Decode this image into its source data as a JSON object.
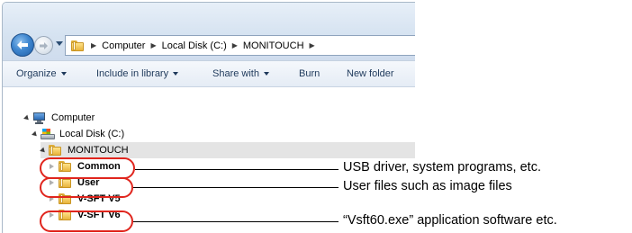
{
  "address_bar": {
    "segments": [
      "Computer",
      "Local Disk (C:)",
      "MONITOUCH"
    ]
  },
  "toolbar": {
    "organize": "Organize",
    "include_in_library": "Include in library",
    "share_with": "Share with",
    "burn": "Burn",
    "new_folder": "New folder"
  },
  "tree": {
    "computer": "Computer",
    "local_disk": "Local Disk (C:)",
    "monitouch": "MONITOUCH",
    "common": "Common",
    "user": "User",
    "vsft_v5": "V-SFT V5",
    "vsft_v6": "V-SFT V6"
  },
  "callouts": {
    "common": "USB driver, system programs, etc.",
    "user": "User files such as image files",
    "vsft_v6": "“Vsft60.exe” application software etc."
  },
  "colors": {
    "highlight": "#e0251d",
    "selected_row": "#e4e4e4",
    "toolbar_text": "#1e395b"
  },
  "icons": {
    "back": "back-arrow-icon",
    "forward": "forward-arrow-icon",
    "folder": "folder-icon",
    "computer": "computer-icon",
    "drive": "local-disk-icon"
  }
}
